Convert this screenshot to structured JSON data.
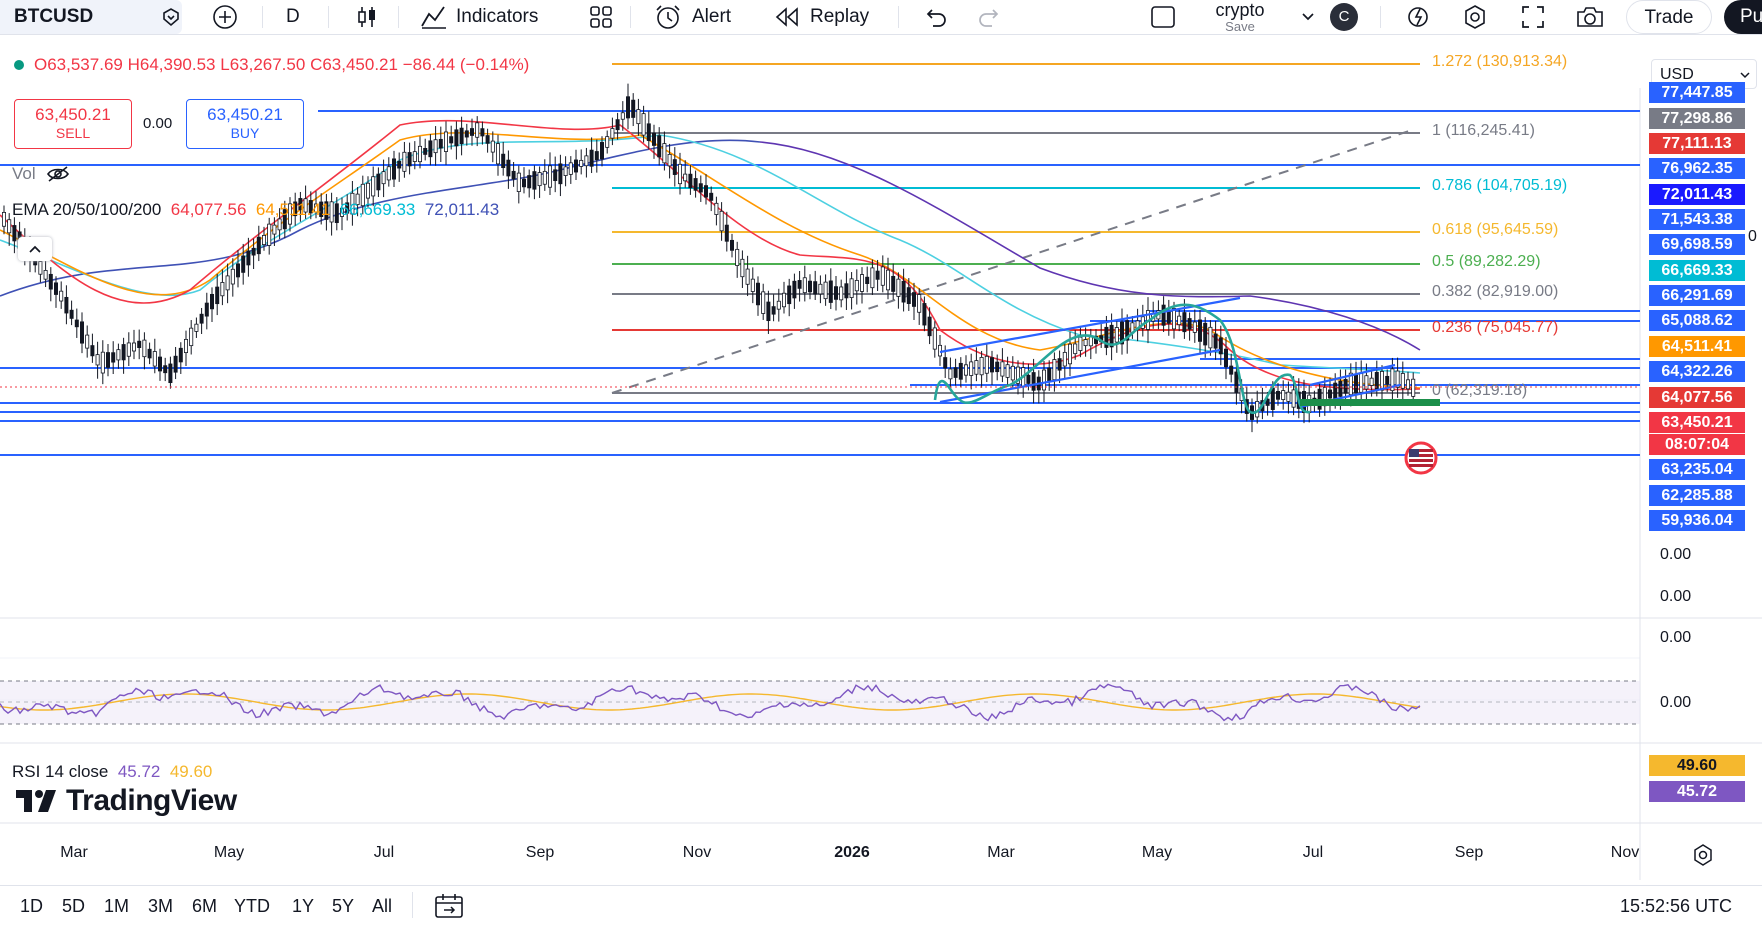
{
  "toolbar": {
    "symbol": "BTCUSD",
    "interval": "D",
    "indicators_label": "Indicators",
    "alert_label": "Alert",
    "replay_label": "Replay",
    "layout_name": "crypto",
    "layout_save": "Save",
    "avatar_letter": "C",
    "trade_label": "Trade",
    "publish_label": "Pu"
  },
  "legend": {
    "open": "O63,537.69",
    "high": "H64,390.53",
    "low": "L63,267.50",
    "close": "C63,450.21",
    "change": "−86.44 (−0.14%)",
    "vol_label": "Vol",
    "ema_label": "EMA 20/50/100/200",
    "ema20": "64,077.56",
    "ema50": "64,511.41",
    "ema100": "66,669.33",
    "ema200": "72,011.43"
  },
  "trade": {
    "sell_price": "63,450.21",
    "sell_label": "SELL",
    "spread": "0.00",
    "buy_price": "63,450.21",
    "buy_label": "BUY"
  },
  "currency": "USD",
  "fib_levels": [
    {
      "label": "1.272 (130,913.34)",
      "color": "#f5a623"
    },
    {
      "label": "1 (116,245.41)",
      "color": "#787b86"
    },
    {
      "label": "0.786 (104,705.19)",
      "color": "#00bcd4"
    },
    {
      "label": "0.618 (95,645.59)",
      "color": "#f5b82e"
    },
    {
      "label": "0.5 (89,282.29)",
      "color": "#4caf50"
    },
    {
      "label": "0.382 (82,919.00)",
      "color": "#787b86"
    },
    {
      "label": "0.236 (75,045.77)",
      "color": "#e53935"
    },
    {
      "label": "0 (62,319.18)",
      "color": "#787b86"
    }
  ],
  "price_labels": [
    {
      "text": "77,447.85",
      "color": "#2962ff"
    },
    {
      "text": "77,298.86",
      "color": "#787b86"
    },
    {
      "text": "77,111.13",
      "color": "#e53935"
    },
    {
      "text": "76,962.35",
      "color": "#2962ff"
    },
    {
      "text": "72,011.43",
      "color": "#1a1aff"
    },
    {
      "text": "71,543.38",
      "color": "#2962ff"
    },
    {
      "text": "69,698.59",
      "color": "#2962ff"
    },
    {
      "text": "66,669.33",
      "color": "#00bcd4"
    },
    {
      "text": "66,291.69",
      "color": "#2962ff"
    },
    {
      "text": "65,088.62",
      "color": "#2962ff"
    },
    {
      "text": "64,511.41",
      "color": "#ff9800"
    },
    {
      "text": "64,322.26",
      "color": "#2962ff"
    },
    {
      "text": "64,077.56",
      "color": "#e53935"
    },
    {
      "text": "63,450.21",
      "color": "#f23645"
    },
    {
      "text": "08:07:04",
      "color": "#f23645"
    },
    {
      "text": "63,235.04",
      "color": "#2962ff"
    },
    {
      "text": "62,285.88",
      "color": "#2962ff"
    },
    {
      "text": "59,936.04",
      "color": "#2962ff"
    }
  ],
  "pane_values": [
    "0.00",
    "0.00",
    "0.00",
    "0.00"
  ],
  "rsi": {
    "label": "RSI 14 close",
    "value": "45.72",
    "ma": "49.60"
  },
  "brand": "TradingView",
  "time_axis": [
    "Mar",
    "May",
    "Jul",
    "Sep",
    "Nov",
    "2026",
    "Mar",
    "May",
    "Jul",
    "Sep",
    "Nov"
  ],
  "ranges": [
    "1D",
    "5D",
    "1M",
    "3M",
    "6M",
    "YTD",
    "1Y",
    "5Y",
    "All"
  ],
  "clock": "15:52:56 UTC"
}
